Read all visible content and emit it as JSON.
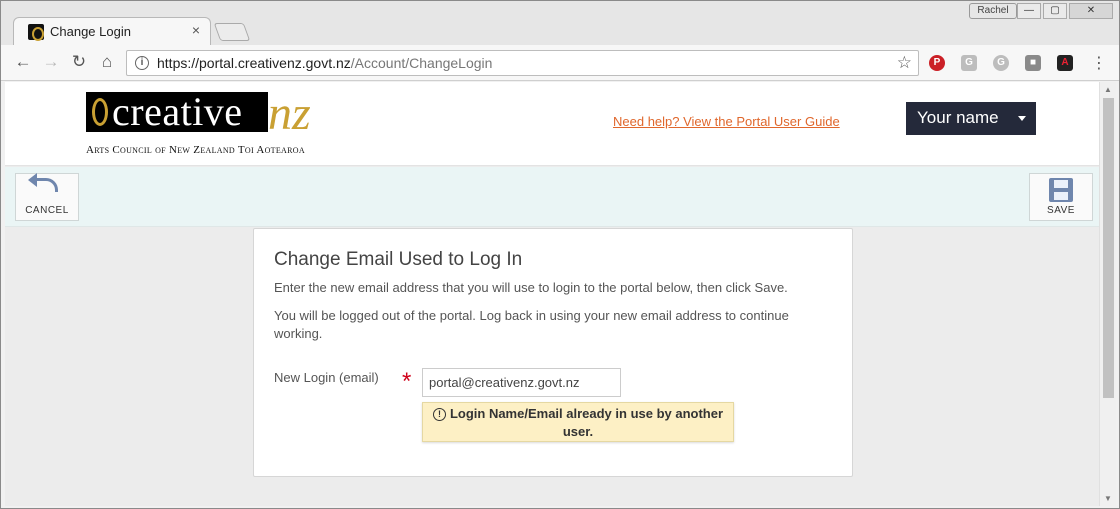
{
  "browser": {
    "tab_title": "Change Login",
    "tab_close": "×",
    "profile_name": "Rachel",
    "url_host": "https://portal.creativenz.govt.nz",
    "url_path": "/Account/ChangeLogin",
    "icons": {
      "back": "←",
      "forward": "→",
      "reload": "↻",
      "home": "⌂",
      "star": "☆",
      "menu": "⋮",
      "info": "i",
      "minimize": "—",
      "maximize": "▢",
      "close": "✕"
    },
    "extensions": [
      "P",
      "G",
      "G",
      "■",
      "A"
    ]
  },
  "header": {
    "logo_word": "creative",
    "logo_nz": "nz",
    "logo_tagline": "Arts Council of New Zealand Toi Aotearoa",
    "help_link": "Need help? View the Portal User Guide",
    "user_menu": "Your name"
  },
  "actions": {
    "cancel_label": "CANCEL",
    "save_label": "SAVE"
  },
  "form": {
    "title": "Change Email Used to Log In",
    "intro": "Enter the new email address that you will use to login to the portal below, then click Save.",
    "logout_note": "You will be logged out of the portal. Log back in using your new email address to continue working.",
    "field_label": "New Login (email)",
    "required_mark": "*",
    "email_value": "portal@creativenz.govt.nz",
    "error_icon": "!",
    "error_message": "Login Name/Email already in use by another user.",
    "error_color": "#fdf0c5"
  },
  "colors": {
    "accent_link": "#e0672c",
    "user_menu_bg": "#24293a",
    "action_bar_bg": "#eaf5f5",
    "logo_gold": "#c9a033",
    "required": "#d0021b"
  }
}
